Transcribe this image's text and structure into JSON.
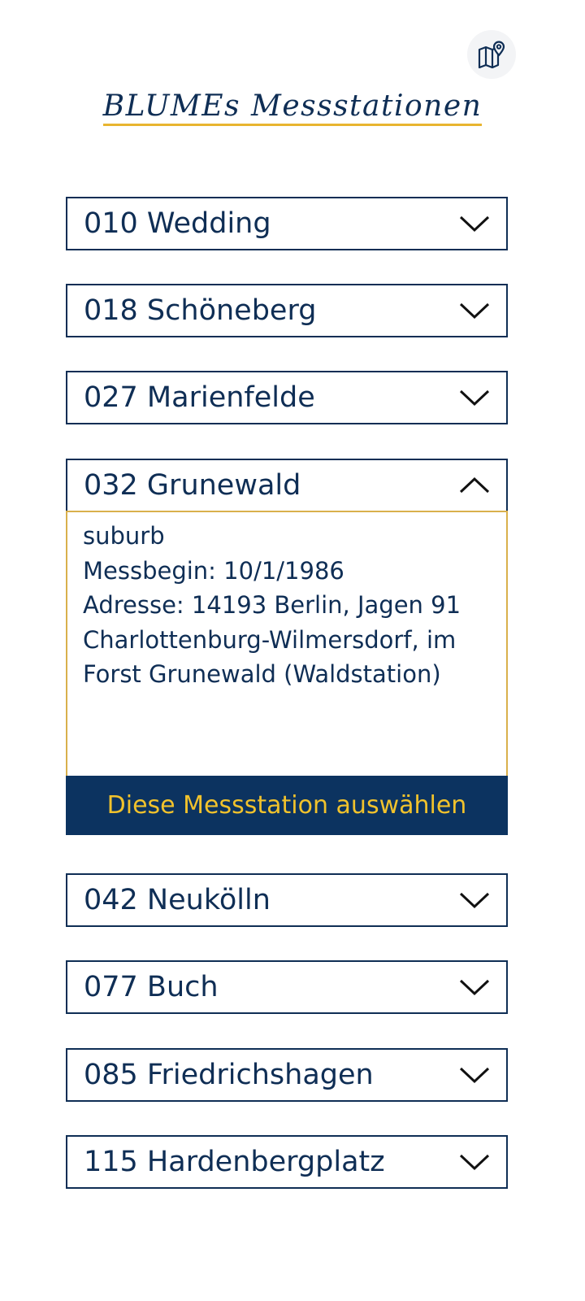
{
  "header": {
    "title": "BLUMEs Messstationen",
    "map_button_icon": "map-pin-icon"
  },
  "stations": [
    {
      "label": "010 Wedding",
      "expanded": false
    },
    {
      "label": "018 Schöneberg",
      "expanded": false
    },
    {
      "label": "027 Marienfelde",
      "expanded": false
    },
    {
      "label": "032 Grunewald",
      "expanded": true,
      "details": {
        "type": "suburb",
        "start": "Messbegin: 10/1/1986",
        "address_line1": "Adresse: 14193 Berlin, Jagen 91",
        "address_line2": "Charlottenburg-Wilmersdorf, im",
        "address_line3": "Forst Grunewald (Waldstation)"
      },
      "select_label": "Diese Messstation auswählen"
    },
    {
      "label": "042 Neukölln",
      "expanded": false
    },
    {
      "label": "077 Buch",
      "expanded": false
    },
    {
      "label": "085 Friedrichshagen",
      "expanded": false
    },
    {
      "label": "115 Hardenbergplatz",
      "expanded": false
    }
  ],
  "colors": {
    "primary": "#0f2e55",
    "button_bg": "#0c3360",
    "accent": "#f1c22c",
    "underline": "#e8b530",
    "expanded_border": "#d9b04c"
  }
}
